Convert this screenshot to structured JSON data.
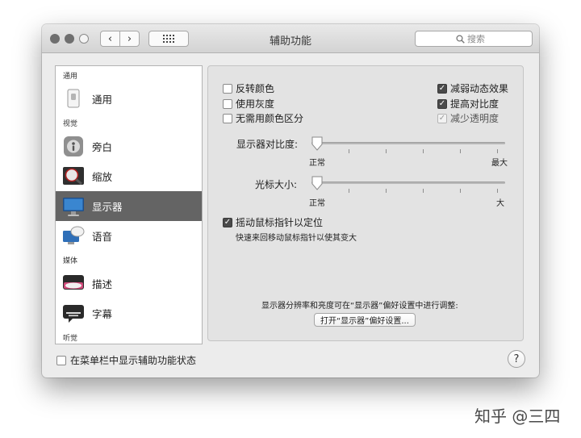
{
  "window": {
    "title": "辅助功能",
    "nav": {
      "back": "‹",
      "forward": "›"
    },
    "search": {
      "placeholder": "搜索",
      "icon": "magnifier-icon"
    }
  },
  "sidebar": {
    "sections": {
      "general": "通用",
      "vision": "视觉",
      "media": "媒体",
      "hearing": "听觉"
    },
    "items": [
      {
        "label": "通用",
        "icon": "switch-device-icon"
      },
      {
        "label": "旁白",
        "icon": "voiceover-icon"
      },
      {
        "label": "缩放",
        "icon": "zoom-magnifier-icon"
      },
      {
        "label": "显示器",
        "icon": "display-monitor-icon",
        "selected": true
      },
      {
        "label": "语音",
        "icon": "speech-bubble-monitor-icon"
      },
      {
        "label": "描述",
        "icon": "description-bubble-icon"
      },
      {
        "label": "字幕",
        "icon": "captions-bubble-icon"
      }
    ]
  },
  "display": {
    "options_left": [
      {
        "label": "反转颜色",
        "checked": false
      },
      {
        "label": "使用灰度",
        "checked": false
      },
      {
        "label": "无需用颜色区分",
        "checked": false
      }
    ],
    "options_right": [
      {
        "label": "减弱动态效果",
        "checked": true
      },
      {
        "label": "提高对比度",
        "checked": true
      },
      {
        "label": "减少透明度",
        "checked": true,
        "disabled": true
      }
    ],
    "contrast_slider": {
      "label": "显示器对比度:",
      "min_label": "正常",
      "max_label": "最大",
      "value": 0
    },
    "cursor_slider": {
      "label": "光标大小:",
      "min_label": "正常",
      "max_label": "大",
      "value": 0
    },
    "shake_cursor": {
      "label": "摇动鼠标指针以定位",
      "checked": true,
      "description": "快速来回移动鼠标指针以使其变大"
    },
    "note": "显示器分辨率和亮度可在“显示器”偏好设置中进行调整:",
    "open_display_prefs": "打开“显示器”偏好设置..."
  },
  "footer": {
    "menu_bar_status": {
      "label": "在菜单栏中显示辅助功能状态",
      "checked": false
    },
    "help": "?"
  },
  "credit": "知乎 @三四",
  "colors": {
    "selected_row": "#646464",
    "checkbox_checked": "#4a4a4a",
    "window_bg": "#ececec",
    "pane_bg": "#e3e3e3"
  }
}
